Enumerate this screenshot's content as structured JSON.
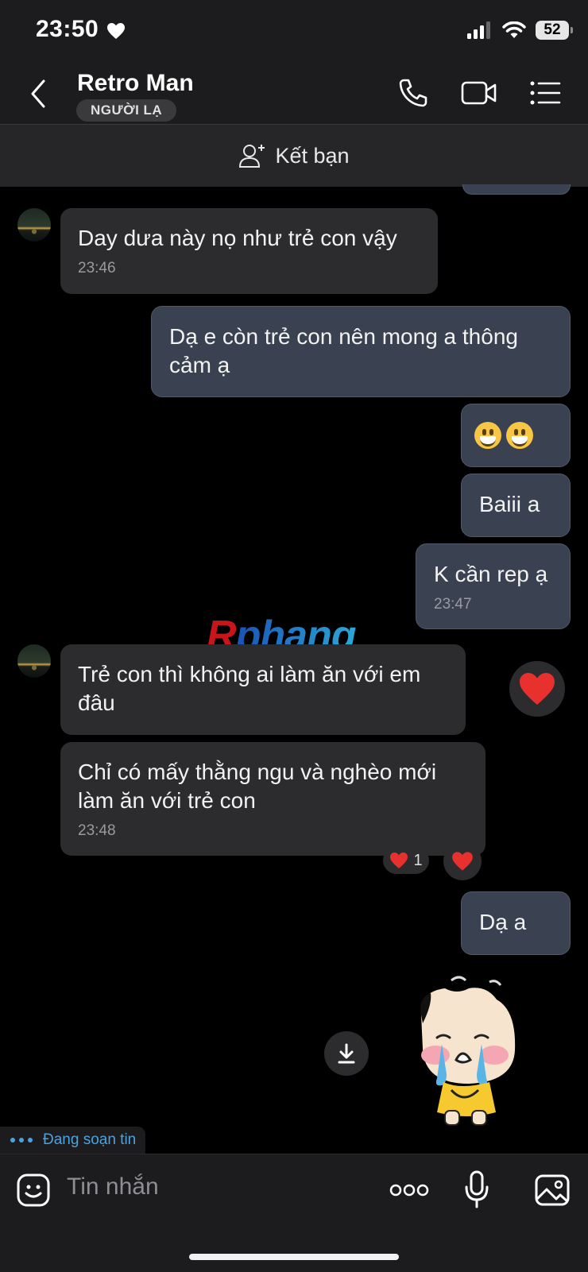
{
  "status_bar": {
    "time": "23:50",
    "battery": "52"
  },
  "header": {
    "name": "Retro Man",
    "badge": "NGƯỜI LẠ"
  },
  "friend_bar": {
    "label": "Kết bạn"
  },
  "messages": [
    {
      "side": "in",
      "text": "Day dưa này nọ như trẻ con vậy",
      "time": "23:46"
    },
    {
      "side": "out",
      "text": "Dạ e còn trẻ con nên mong a thông cảm ạ"
    },
    {
      "side": "out",
      "emoji": [
        "grinning-face",
        "grinning-face"
      ]
    },
    {
      "side": "out",
      "text": "Baiii a"
    },
    {
      "side": "out",
      "text": "K cần rep ạ",
      "time": "23:47"
    },
    {
      "side": "in",
      "text": "Trẻ con thì không ai làm ăn với em đâu"
    },
    {
      "side": "in",
      "text": "Chỉ có mấy thằng ngu và nghèo mới làm ăn với trẻ con",
      "time": "23:48",
      "reaction": {
        "emoji": "heart",
        "count": "1"
      }
    },
    {
      "side": "out",
      "text": "Dạ a"
    }
  ],
  "watermark": {
    "r": "R",
    "rest": "phang"
  },
  "typing": {
    "label": "Đang soạn tin"
  },
  "composer": {
    "placeholder": "Tin nhắn"
  }
}
